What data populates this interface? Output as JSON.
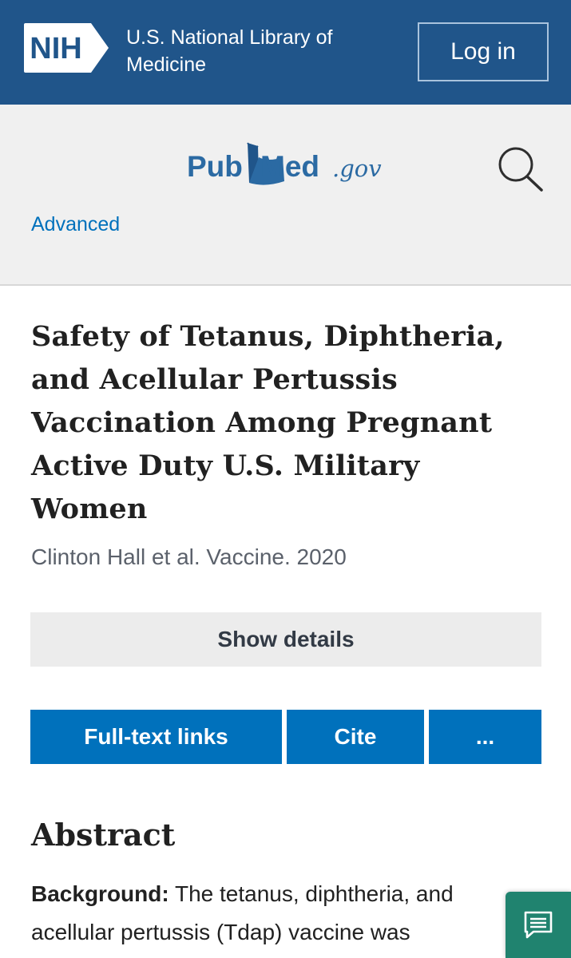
{
  "header": {
    "logo_text": "NIH",
    "org_line1": "U.S. National Library of",
    "org_line2": "Medicine",
    "login_label": "Log in"
  },
  "search": {
    "logo_pub": "Pub",
    "logo_med": "Med",
    "logo_suffix": ".gov",
    "search_icon": "search-icon",
    "advanced_label": "Advanced"
  },
  "article": {
    "title": "Safety of Tetanus, Diphtheria, and Acellular Pertussis Vaccination Among Pregnant Active Duty U.S. Military Women",
    "meta": "Clinton Hall et al. Vaccine. 2020",
    "show_details_label": "Show details"
  },
  "actions": {
    "fulltext_label": "Full-text links",
    "cite_label": "Cite",
    "more_label": "..."
  },
  "abstract": {
    "heading": "Abstract",
    "background_label": "Background:",
    "background_text": " The tetanus, diphtheria, and acellular pertussis (Tdap) vaccine was"
  },
  "feedback": {
    "icon": "comment-icon"
  },
  "colors": {
    "nih_blue": "#20558a",
    "pubmed_blue": "#0071bc",
    "band_gray": "#f0f0f0",
    "feedback_green": "#20836f"
  }
}
